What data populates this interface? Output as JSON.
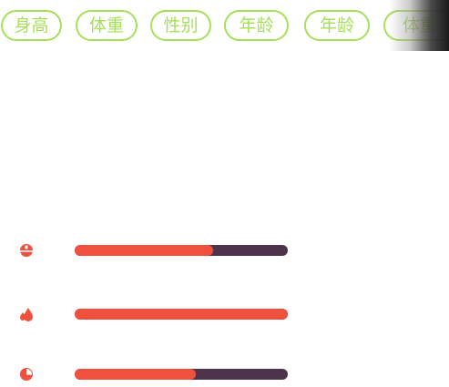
{
  "tags": [
    {
      "label": "身高"
    },
    {
      "label": "体重"
    },
    {
      "label": "性别"
    },
    {
      "label": "年龄"
    },
    {
      "label": "年龄"
    },
    {
      "label": "体重"
    }
  ],
  "bars": [
    {
      "icon": "bowl-icon",
      "progress": 0.65
    },
    {
      "icon": "flame-drops-icon",
      "progress": 1.0
    },
    {
      "icon": "pie-icon",
      "progress": 0.57
    }
  ],
  "colors": {
    "tag_accent": "#a6e05a",
    "bar_fill": "#f0503e",
    "bar_track": "#4e344b"
  }
}
